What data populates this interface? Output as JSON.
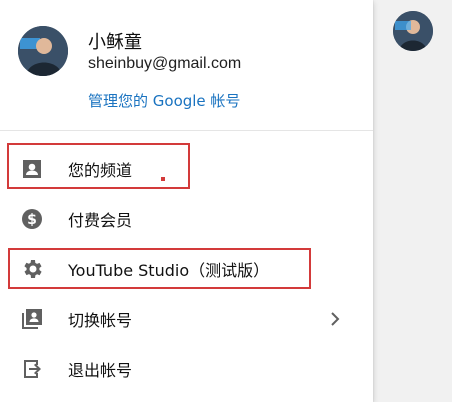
{
  "account": {
    "name": "小稣童",
    "email": "sheinbuy@gmail.com",
    "manage_link": "管理您的 Google 帐号"
  },
  "menu_items": [
    {
      "label": "您的频道",
      "icon": "person-box-icon"
    },
    {
      "label": "付费会员",
      "icon": "dollar-circle-icon"
    },
    {
      "label": "YouTube Studio（测试版）",
      "icon": "gear-icon"
    },
    {
      "label": "切换帐号",
      "icon": "switch-accounts-icon"
    },
    {
      "label": "退出帐号",
      "icon": "sign-out-icon"
    }
  ],
  "colors": {
    "link": "#1a73c0",
    "highlight": "#d33a3a",
    "icon": "#606060"
  }
}
